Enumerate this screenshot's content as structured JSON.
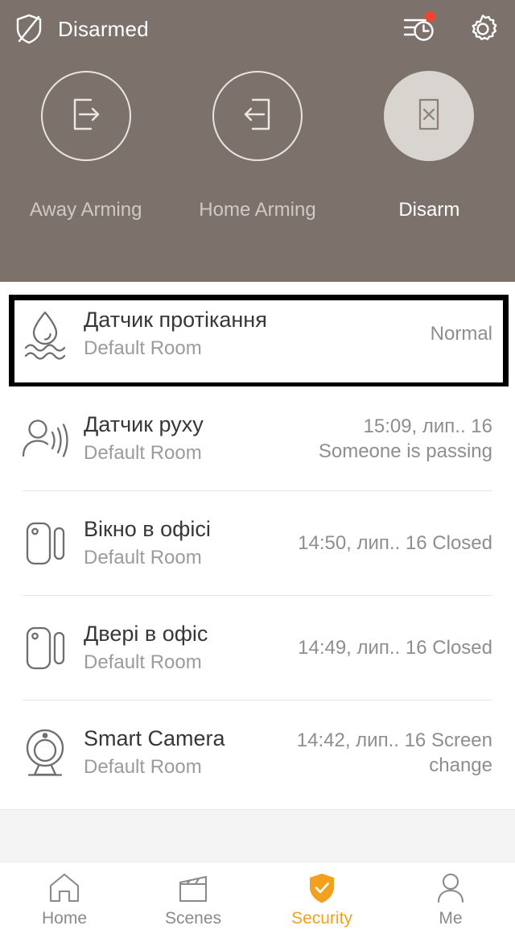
{
  "colors": {
    "header_bg": "#7d726b",
    "accent": "#f2a01e",
    "badge": "#f2442e",
    "disarm_fill": "#d8d4d0",
    "highlight_border": "#000000",
    "filler_bg": "#f4f4f4"
  },
  "header": {
    "shield_icon": "shield-slash-icon",
    "status_text": "Disarmed",
    "history_icon": "history-clock-icon",
    "history_has_badge": true,
    "settings_icon": "gear-icon"
  },
  "arm_modes": [
    {
      "id": "away",
      "label": "Away Arming",
      "icon": "door-exit-right-icon",
      "active": false
    },
    {
      "id": "home",
      "label": "Home Arming",
      "icon": "door-enter-left-icon",
      "active": false
    },
    {
      "id": "disarm",
      "label": "Disarm",
      "icon": "door-cross-icon",
      "active": true
    }
  ],
  "devices": [
    {
      "icon": "water-leak-icon",
      "name": "Датчик протікання",
      "room": "Default Room",
      "status": "Normal",
      "highlighted": true
    },
    {
      "icon": "motion-sensor-icon",
      "name": "Датчик руху",
      "room": "Default Room",
      "status": "15:09, лип.. 16\nSomeone is passing",
      "highlighted": false
    },
    {
      "icon": "contact-sensor-icon",
      "name": "Вікно в офісі",
      "room": "Default Room",
      "status": "14:50, лип.. 16 Closed",
      "highlighted": false
    },
    {
      "icon": "contact-sensor-icon",
      "name": "Двері в офіс",
      "room": "Default Room",
      "status": "14:49, лип.. 16 Closed",
      "highlighted": false
    },
    {
      "icon": "camera-icon",
      "name": "Smart Camera",
      "room": "Default Room",
      "status": "14:42, лип.. 16 Screen change",
      "highlighted": false
    }
  ],
  "tabs": [
    {
      "id": "home",
      "label": "Home",
      "icon": "home-icon",
      "active": false
    },
    {
      "id": "scenes",
      "label": "Scenes",
      "icon": "clapperboard-icon",
      "active": false
    },
    {
      "id": "security",
      "label": "Security",
      "icon": "shield-check-icon",
      "active": true
    },
    {
      "id": "me",
      "label": "Me",
      "icon": "person-icon",
      "active": false
    }
  ]
}
